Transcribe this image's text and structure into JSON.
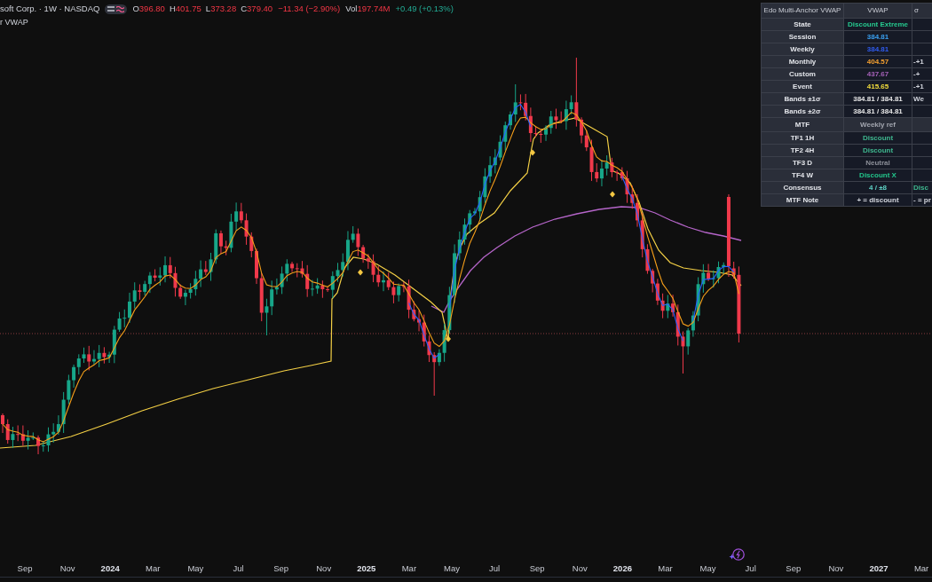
{
  "legend": {
    "title": "soft Corp. · 1W · NASDAQ",
    "ohlc": [
      {
        "label": "O",
        "value": "396.80"
      },
      {
        "label": "H",
        "value": "401.75"
      },
      {
        "label": "L",
        "value": "373.28"
      },
      {
        "label": "C",
        "value": "379.40"
      }
    ],
    "down": true,
    "change": "−11.34 (−2.90%)",
    "volume": {
      "label": "Vol",
      "value": "197.74M",
      "down": true
    },
    "volume_change": {
      "text": "+0.49 (+0.13%)",
      "down": false
    }
  },
  "indicator": {
    "name": "r VWAP"
  },
  "table": {
    "columns": [
      "Edo Multi-Anchor VWAP",
      "VWAP",
      "σ"
    ],
    "rows": [
      {
        "label": "State",
        "value": "Discount Extreme",
        "color": "#26c98f",
        "kind": "data"
      },
      {
        "label": "Session",
        "value": "384.81",
        "color": "#3aa0f0",
        "kind": "data"
      },
      {
        "label": "Weekly",
        "value": "384.81",
        "color": "#2f5cf0",
        "kind": "data"
      },
      {
        "label": "Monthly",
        "value": "404.57",
        "color": "#f5a030",
        "kind": "data",
        "column_3": {
          "text": "-+1",
          "color": "#d1d4dc"
        }
      },
      {
        "label": "Custom",
        "value": "437.67",
        "color": "#a561b8",
        "kind": "data",
        "column_3": {
          "text": "-+",
          "color": "#d1d4dc"
        }
      },
      {
        "label": "Event",
        "value": "415.65",
        "color": "#f2dc3c",
        "kind": "data",
        "column_3": {
          "text": "-+1",
          "color": "#d1d4dc"
        }
      },
      {
        "label": "Bands ±1σ",
        "value": "384.81 / 384.81",
        "color": "#e8e8e8",
        "kind": "data",
        "column_3": {
          "text": "We",
          "color": "#d1d4dc"
        }
      },
      {
        "label": "Bands ±2σ",
        "value": "384.81 / 384.81",
        "color": "#e8e8e8",
        "kind": "data"
      },
      {
        "label": "MTF",
        "value": "Weekly ref",
        "color": "#a3a6af",
        "kind": "section"
      },
      {
        "label": "TF1 1H",
        "value": "Discount",
        "color": "#3fb88f",
        "kind": "data"
      },
      {
        "label": "TF2 4H",
        "value": "Discount",
        "color": "#3fb88f",
        "kind": "data"
      },
      {
        "label": "TF3 D",
        "value": "Neutral",
        "color": "#8d9099",
        "kind": "data"
      },
      {
        "label": "TF4 W",
        "value": "Discount X",
        "color": "#22c58b",
        "kind": "data"
      },
      {
        "label": "Consensus",
        "value": "4 / ±8",
        "color": "#5fd3c6",
        "kind": "data",
        "column_3": {
          "text": "Disc",
          "color": "#3fb88f"
        }
      },
      {
        "label": "MTF Note",
        "value": "+ = discount",
        "color": "#d1d4dc",
        "kind": "data",
        "column_3": {
          "text": "- = pr",
          "color": "#d1d4dc"
        }
      }
    ]
  },
  "time_axis": {
    "labels": [
      {
        "text": "Sep",
        "kind": "month"
      },
      {
        "text": "Nov",
        "kind": "month"
      },
      {
        "text": "2024",
        "kind": "year"
      },
      {
        "text": "Mar",
        "kind": "month"
      },
      {
        "text": "May",
        "kind": "month"
      },
      {
        "text": "Jul",
        "kind": "month"
      },
      {
        "text": "Sep",
        "kind": "month"
      },
      {
        "text": "Nov",
        "kind": "month"
      },
      {
        "text": "2025",
        "kind": "year"
      },
      {
        "text": "Mar",
        "kind": "month"
      },
      {
        "text": "May",
        "kind": "month"
      },
      {
        "text": "Jul",
        "kind": "month"
      },
      {
        "text": "Sep",
        "kind": "month"
      },
      {
        "text": "Nov",
        "kind": "month"
      },
      {
        "text": "2026",
        "kind": "year"
      },
      {
        "text": "Mar",
        "kind": "month"
      },
      {
        "text": "May",
        "kind": "month"
      },
      {
        "text": "Jul",
        "kind": "month"
      },
      {
        "text": "Sep",
        "kind": "month"
      },
      {
        "text": "Nov",
        "kind": "month"
      },
      {
        "text": "2027",
        "kind": "year"
      },
      {
        "text": "Mar",
        "kind": "month"
      }
    ]
  }
}
